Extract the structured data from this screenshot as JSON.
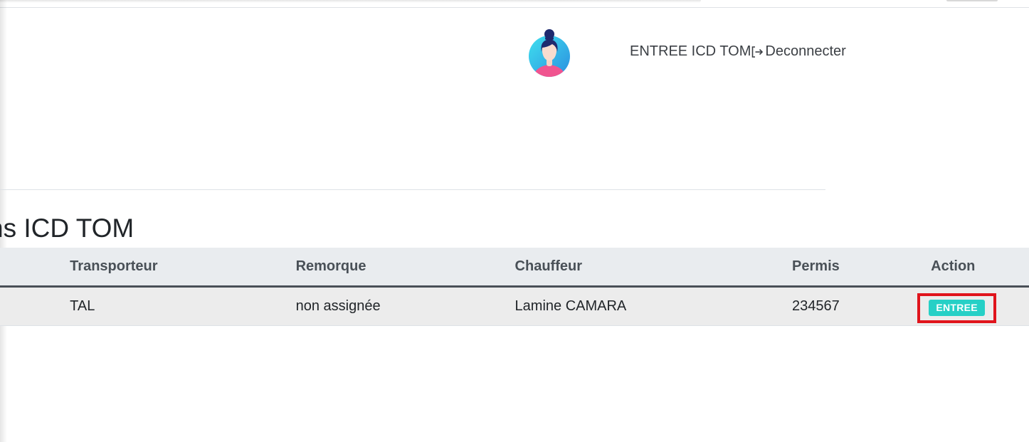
{
  "header": {
    "user_name": "ENTREE ICD TOM",
    "logout_label": "Deconnecter",
    "icons": [
      "avatar",
      "logout-icon"
    ]
  },
  "section": {
    "title": "ns ICD TOM"
  },
  "table": {
    "columns": [
      "",
      "Transporteur",
      "Remorque",
      "Chauffeur",
      "Permis",
      "Action"
    ],
    "rows": [
      {
        "first": "",
        "transporteur": "TAL",
        "remorque": "non assignée",
        "chauffeur": "Lamine CAMARA",
        "permis": "234567",
        "action_label": "ENTREE"
      }
    ]
  },
  "colors": {
    "action_button": "#26d0c6",
    "highlight_border": "#e0141c",
    "header_bg": "#e9ecef"
  }
}
